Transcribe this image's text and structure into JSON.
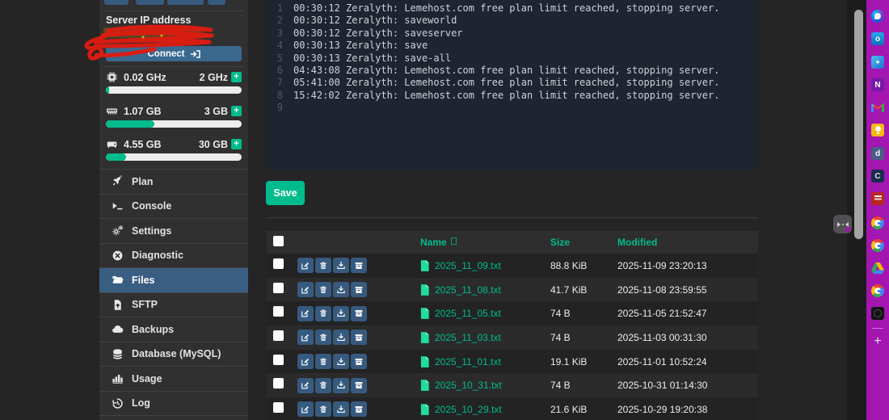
{
  "server_panel": {
    "ip_label": "Server IP address",
    "connect": {
      "label": "Connect"
    },
    "meters": [
      {
        "icon": "cpu-icon",
        "used": "0.02 GHz",
        "max": "2 GHz",
        "percent": 1,
        "add_label": "+"
      },
      {
        "icon": "memory-icon",
        "used": "1.07 GB",
        "max": "3 GB",
        "percent": 36,
        "add_label": "+"
      },
      {
        "icon": "disk-icon",
        "used": "4.55 GB",
        "max": "30 GB",
        "percent": 15,
        "add_label": "+"
      }
    ],
    "menu": [
      {
        "icon": "rocket-icon",
        "label": "Plan"
      },
      {
        "icon": "terminal-icon",
        "label": "Console"
      },
      {
        "icon": "gears-icon",
        "label": "Settings"
      },
      {
        "icon": "diagnostic-icon",
        "label": "Diagnostic"
      },
      {
        "icon": "folder-icon",
        "label": "Files",
        "active": true
      },
      {
        "icon": "file-upload-icon",
        "label": "SFTP"
      },
      {
        "icon": "cloud-icon",
        "label": "Backups"
      },
      {
        "icon": "database-icon",
        "label": "Database (MySQL)"
      },
      {
        "icon": "bar-chart-icon",
        "label": "Usage"
      },
      {
        "icon": "history-icon",
        "label": "Log"
      }
    ]
  },
  "console": {
    "lines": [
      {
        "num": "1",
        "text": "00:30:12 Zeralyth: Lemehost.com free plan limit reached, stopping server."
      },
      {
        "num": "2",
        "text": "00:30:12 Zeralyth: saveworld"
      },
      {
        "num": "3",
        "text": "00:30:12 Zeralyth: saveserver"
      },
      {
        "num": "4",
        "text": "00:30:13 Zeralyth: save"
      },
      {
        "num": "5",
        "text": "00:30:13 Zeralyth: save-all"
      },
      {
        "num": "6",
        "text": "04:43:08 Zeralyth: Lemehost.com free plan limit reached, stopping server."
      },
      {
        "num": "7",
        "text": "05:41:00 Zeralyth: Lemehost.com free plan limit reached, stopping server."
      },
      {
        "num": "8",
        "text": "15:42:02 Zeralyth: Lemehost.com free plan limit reached, stopping server."
      },
      {
        "num": "9",
        "text": ""
      }
    ]
  },
  "editor": {
    "save_label": "Save"
  },
  "files": {
    "header": {
      "name": "Name",
      "size": "Size",
      "modified": "Modified"
    },
    "rows": [
      {
        "name": "2025_11_09.txt",
        "size": "88.8 KiB",
        "modified": "2025-11-09 23:20:13"
      },
      {
        "name": "2025_11_08.txt",
        "size": "41.7 KiB",
        "modified": "2025-11-08 23:59:55"
      },
      {
        "name": "2025_11_05.txt",
        "size": "74 B",
        "modified": "2025-11-05 21:52:47"
      },
      {
        "name": "2025_11_03.txt",
        "size": "74 B",
        "modified": "2025-11-03 00:31:30"
      },
      {
        "name": "2025_11_01.txt",
        "size": "19.1 KiB",
        "modified": "2025-11-01 10:52:24"
      },
      {
        "name": "2025_10_31.txt",
        "size": "74 B",
        "modified": "2025-10-31 01:14:30"
      },
      {
        "name": "2025_10_29.txt",
        "size": "21.6 KiB",
        "modified": "2025-10-29 19:20:38"
      }
    ]
  },
  "browser": {
    "add_label": "+",
    "sidebar_icons": [
      {
        "name": "m365-copilot-icon"
      },
      {
        "name": "outlook-icon",
        "label": "o"
      },
      {
        "name": "designer-icon",
        "label": "✦"
      },
      {
        "name": "onenote-icon",
        "label": "N"
      },
      {
        "name": "gmail-icon",
        "label": "M"
      },
      {
        "name": "lamp-icon"
      },
      {
        "name": "daily-dev-icon",
        "label": "d"
      },
      {
        "name": "claude-icon",
        "label": "C"
      },
      {
        "name": "bible-icon"
      },
      {
        "name": "google-icon",
        "label": "G"
      },
      {
        "name": "google-icon",
        "label": "G"
      },
      {
        "name": "drive-icon"
      },
      {
        "name": "google-icon",
        "label": "G"
      },
      {
        "name": "site-favicon-icon"
      }
    ]
  },
  "colors": {
    "accent_green": "#00bc8c",
    "accent_blue": "#375a7f",
    "edge_purple": "#a316b0",
    "console_bg": "#1f2430"
  }
}
